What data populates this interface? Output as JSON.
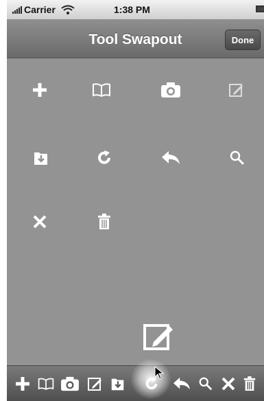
{
  "status_bar": {
    "carrier": "Carrier",
    "time": "1:38 PM"
  },
  "nav_bar": {
    "title": "Tool Swapout",
    "done_label": "Done"
  },
  "palette_icons": [
    "plus-icon",
    "book-icon",
    "camera-icon",
    "compose-icon",
    "file-import-icon",
    "refresh-icon",
    "reply-icon",
    "search-icon",
    "close-icon",
    "trash-icon"
  ],
  "dragging_icon": "compose-icon",
  "toolbar_icons": [
    "plus-icon",
    "book-icon",
    "camera-icon",
    "compose-icon",
    "file-import-icon",
    "refresh-icon",
    "reply-icon",
    "search-icon",
    "close-icon",
    "trash-icon"
  ]
}
